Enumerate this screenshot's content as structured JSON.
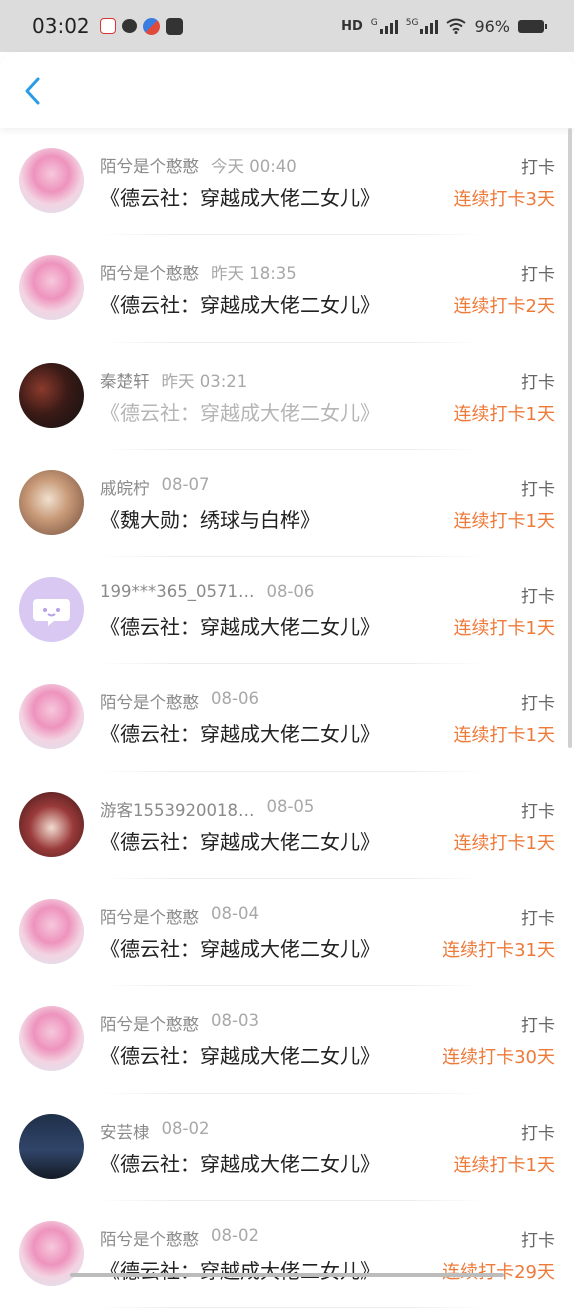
{
  "status_bar": {
    "time": "03:02",
    "hd_label": "HD",
    "g_label": "G",
    "fiveg_label": "5G",
    "battery": "96%"
  },
  "colors": {
    "accent": "#ee7a3a",
    "back_arrow": "#2a9be8",
    "divider": "#ececec"
  },
  "checkins": [
    {
      "user": "陌兮是个憨憨",
      "time": "今天 00:40",
      "book": "《德云社：穿越成大佬二女儿》",
      "action": "打卡",
      "streak": "连续打卡3天",
      "avatar": "pink-anime-avatar",
      "faded": false
    },
    {
      "user": "陌兮是个憨憨",
      "time": "昨天 18:35",
      "book": "《德云社：穿越成大佬二女儿》",
      "action": "打卡",
      "streak": "连续打卡2天",
      "avatar": "pink-anime-avatar",
      "faded": false
    },
    {
      "user": "秦楚轩",
      "time": "昨天 03:21",
      "book": "《德云社：穿越成大佬二女儿》",
      "action": "打卡",
      "streak": "连续打卡1天",
      "avatar": "dark-photo-avatar",
      "faded": true
    },
    {
      "user": "戚皖柠",
      "time": "08-07",
      "book": "《魏大勋：绣球与白桦》",
      "action": "打卡",
      "streak": "连续打卡1天",
      "avatar": "portrait-avatar",
      "faded": false
    },
    {
      "user": "199***365_0571…",
      "time": "08-06",
      "book": "《德云社：穿越成大佬二女儿》",
      "action": "打卡",
      "streak": "连续打卡1天",
      "avatar": "default-chat-avatar",
      "faded": false
    },
    {
      "user": "陌兮是个憨憨",
      "time": "08-06",
      "book": "《德云社：穿越成大佬二女儿》",
      "action": "打卡",
      "streak": "连续打卡1天",
      "avatar": "pink-anime-avatar",
      "faded": false
    },
    {
      "user": "游客1553920018…",
      "time": "08-05",
      "book": "《德云社：穿越成大佬二女儿》",
      "action": "打卡",
      "streak": "连续打卡1天",
      "avatar": "red-hair-avatar",
      "faded": false
    },
    {
      "user": "陌兮是个憨憨",
      "time": "08-04",
      "book": "《德云社：穿越成大佬二女儿》",
      "action": "打卡",
      "streak": "连续打卡31天",
      "avatar": "pink-anime-avatar",
      "faded": false
    },
    {
      "user": "陌兮是个憨憨",
      "time": "08-03",
      "book": "《德云社：穿越成大佬二女儿》",
      "action": "打卡",
      "streak": "连续打卡30天",
      "avatar": "pink-anime-avatar",
      "faded": false
    },
    {
      "user": "安芸棣",
      "time": "08-02",
      "book": "《德云社：穿越成大佬二女儿》",
      "action": "打卡",
      "streak": "连续打卡1天",
      "avatar": "night-sky-avatar",
      "faded": false
    },
    {
      "user": "陌兮是个憨憨",
      "time": "08-02",
      "book": "《德云社：穿越成大佬二女儿》",
      "action": "打卡",
      "streak": "连续打卡29天",
      "avatar": "pink-anime-avatar",
      "faded": false
    }
  ]
}
